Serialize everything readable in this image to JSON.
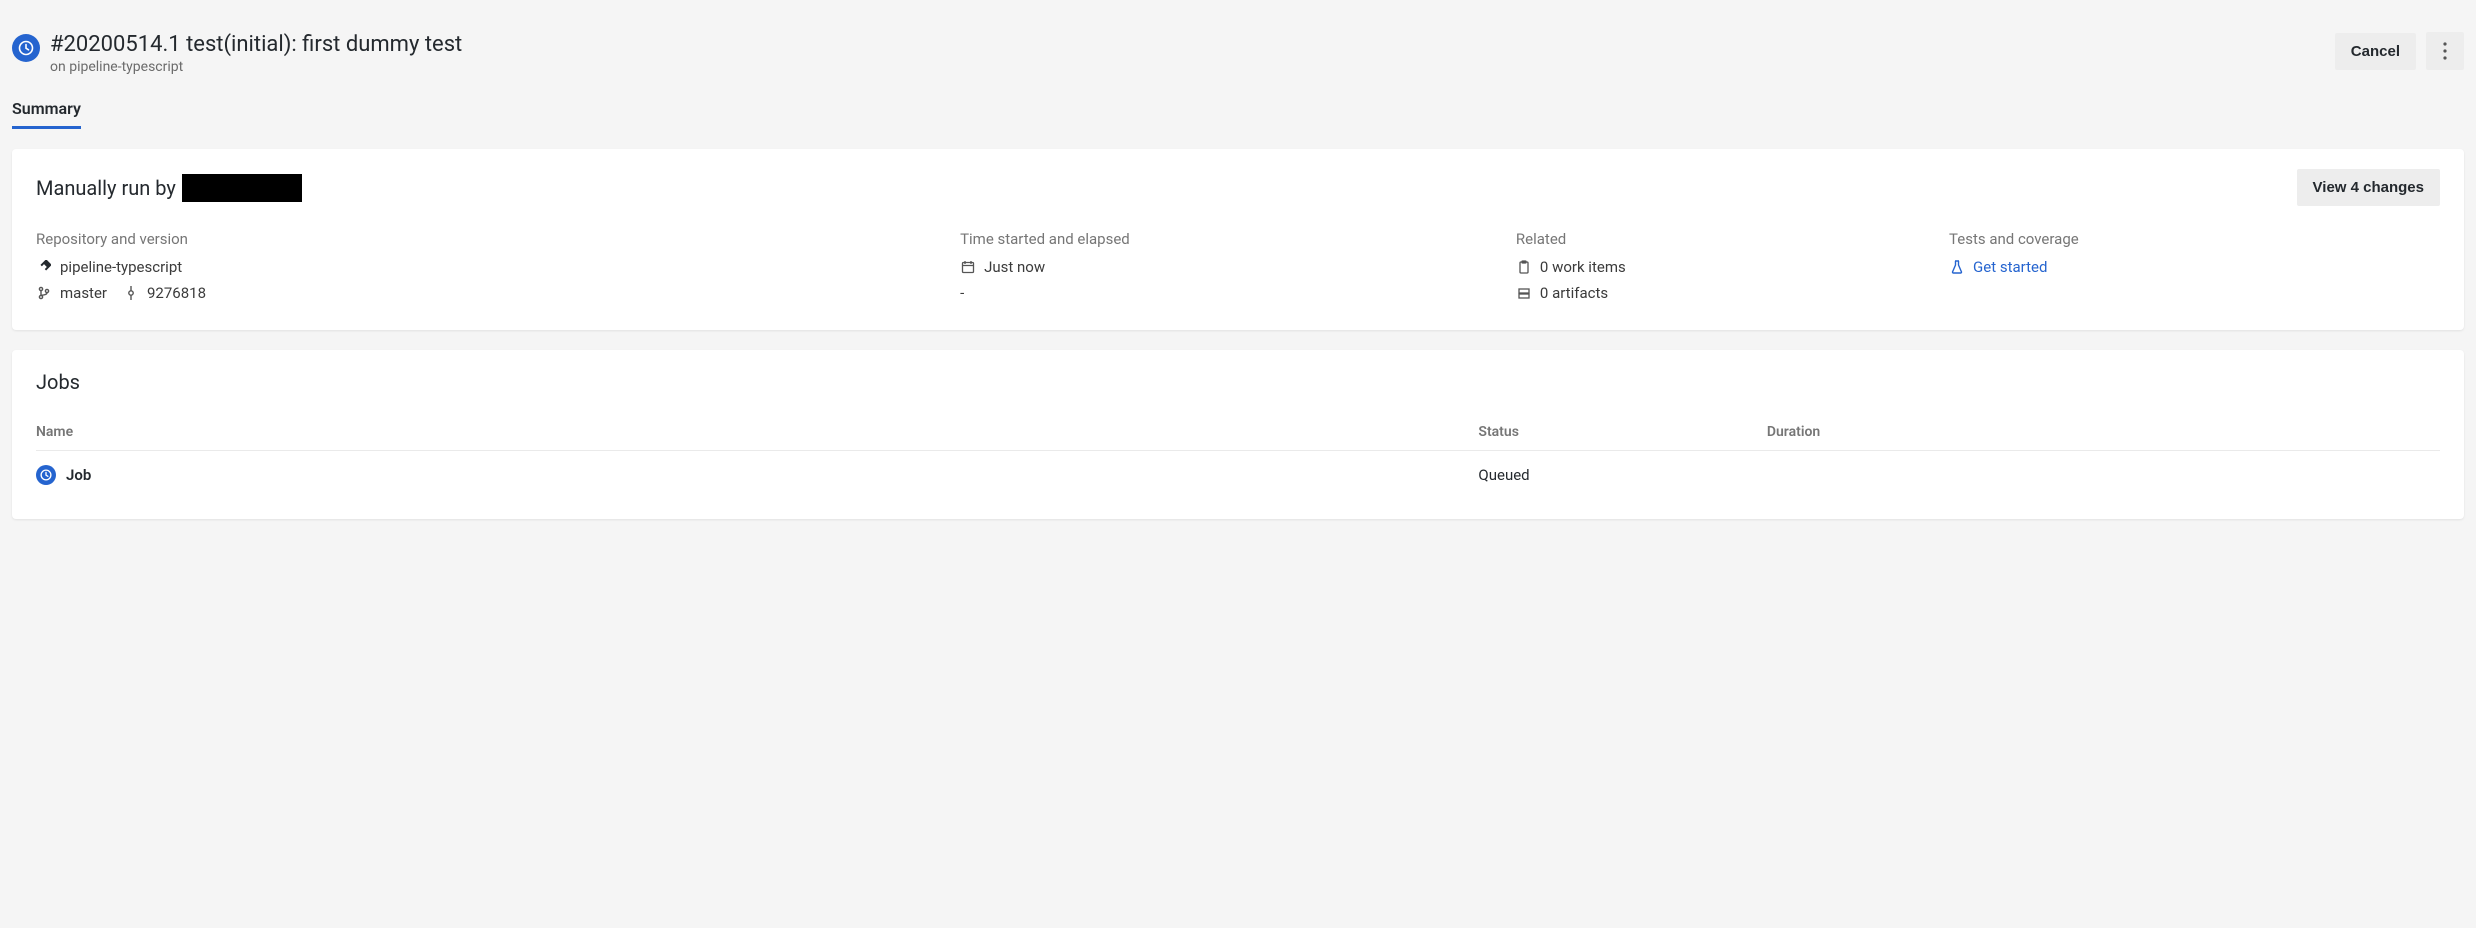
{
  "colors": {
    "accent": "#2564cf"
  },
  "header": {
    "title": "#20200514.1 test(initial): first dummy test",
    "subtitle_prefix": "on ",
    "subtitle_pipeline": "pipeline-typescript",
    "cancel": "Cancel"
  },
  "tabs": {
    "summary": "Summary"
  },
  "run": {
    "trigger_prefix": "Manually run by ",
    "view_changes": "View 4 changes",
    "repo": {
      "label": "Repository and version",
      "repo_name": "pipeline-typescript",
      "branch": "master",
      "commit": "9276818"
    },
    "time": {
      "label": "Time started and elapsed",
      "started": "Just now",
      "elapsed": "-"
    },
    "related": {
      "label": "Related",
      "work_items": "0 work items",
      "artifacts": "0 artifacts"
    },
    "tests": {
      "label": "Tests and coverage",
      "link": "Get started"
    }
  },
  "jobs": {
    "heading": "Jobs",
    "columns": {
      "name": "Name",
      "status": "Status",
      "duration": "Duration"
    },
    "rows": [
      {
        "name": "Job",
        "status": "Queued",
        "duration": ""
      }
    ]
  }
}
